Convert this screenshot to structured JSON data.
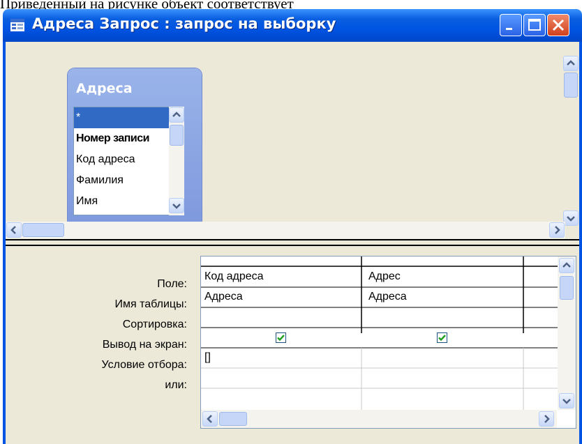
{
  "caption": "Приведенный на рисунке объект соответствует",
  "window": {
    "title": "Адреса Запрос : запрос на выборку",
    "controls": {
      "minimize": "minimize-icon",
      "maximize": "maximize-icon",
      "close": "close-icon"
    }
  },
  "table_box": {
    "title": "Адреса",
    "fields": [
      "*",
      "Номер записи",
      "Код адреса",
      "Фамилия",
      "Имя"
    ],
    "selected_index": 0,
    "bold_index": 1
  },
  "grid": {
    "row_labels": [
      "Поле:",
      "Имя таблицы:",
      "Сортировка:",
      "Вывод на экран:",
      "Условие отбора:",
      "или:"
    ],
    "columns": [
      {
        "field": "Код адреса",
        "table": "Адреса",
        "sort": "",
        "show": true,
        "criteria": "[]",
        "or": ""
      },
      {
        "field": "Адрес",
        "table": "Адреса",
        "sort": "",
        "show": true,
        "criteria": "",
        "or": ""
      }
    ]
  },
  "colors": {
    "title_bar": "#0054e3",
    "window_bg": "#ece9d8",
    "selection": "#316ac5",
    "check": "#21a121"
  }
}
